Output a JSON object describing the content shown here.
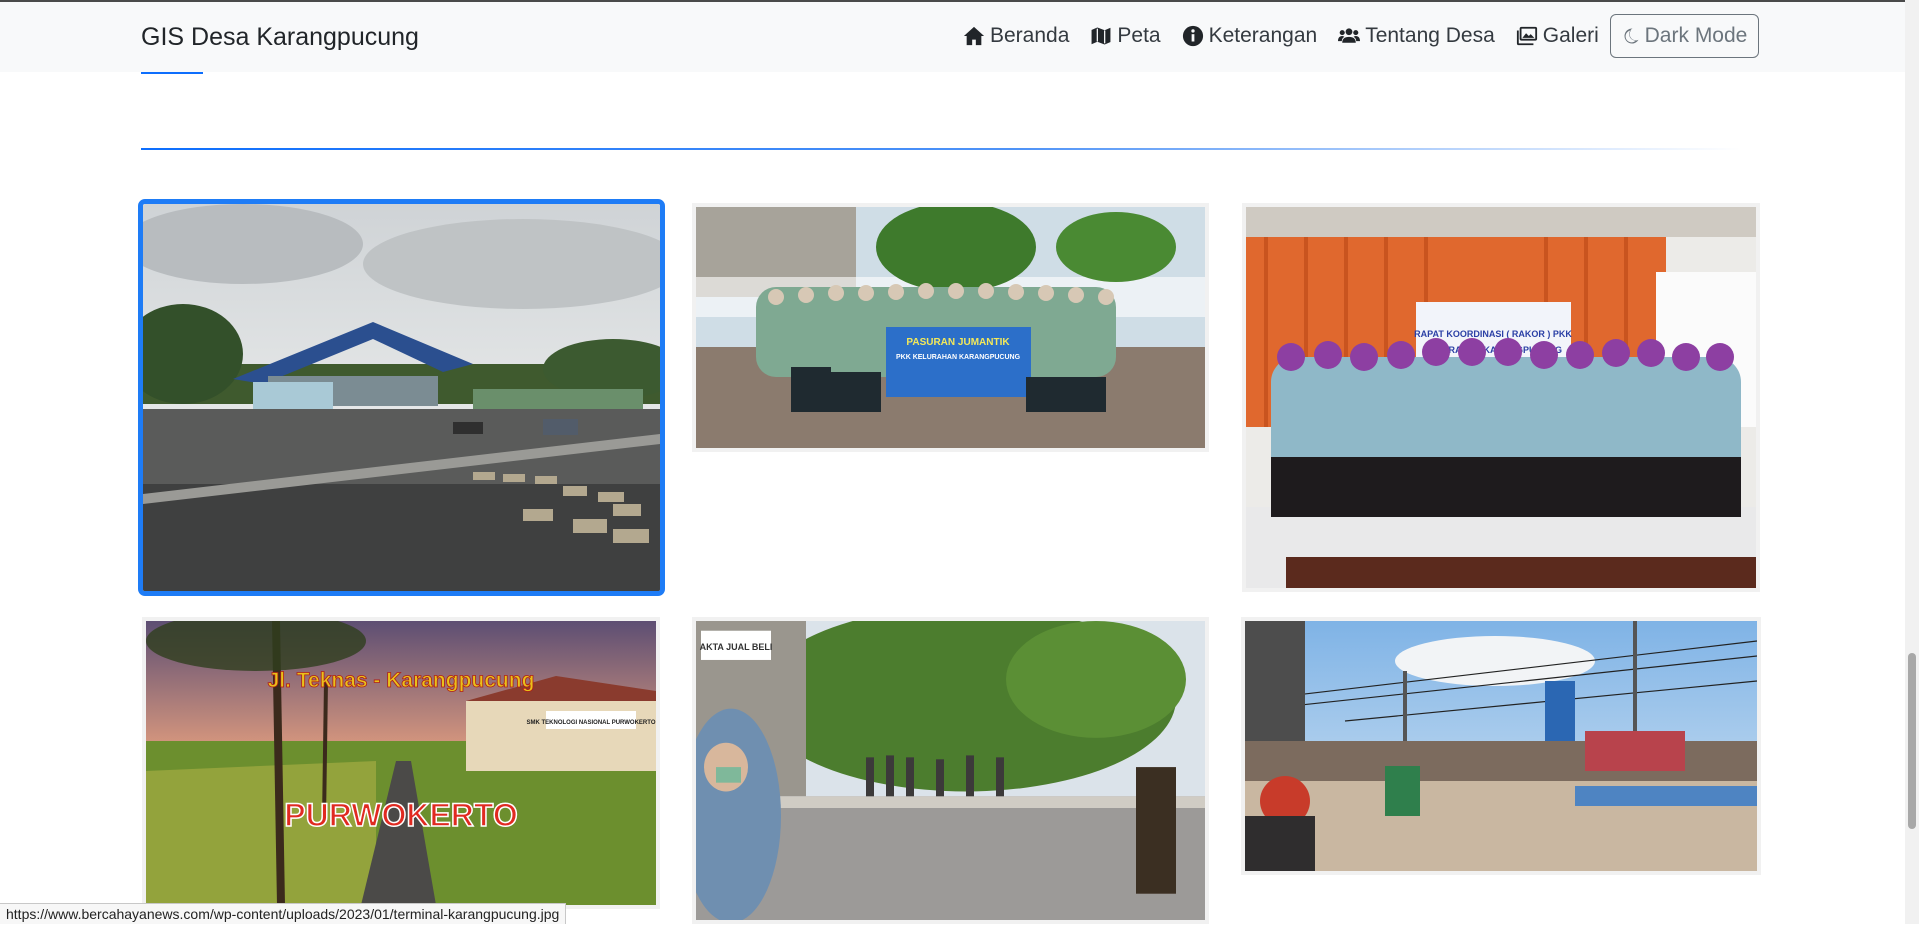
{
  "brand": "GIS Desa Karangpucung",
  "nav": {
    "items": [
      {
        "label": "Beranda",
        "icon": "home-icon"
      },
      {
        "label": "Peta",
        "icon": "map-icon"
      },
      {
        "label": "Keterangan",
        "icon": "info-circle-icon"
      },
      {
        "label": "Tentang Desa",
        "icon": "users-icon"
      },
      {
        "label": "Galeri",
        "icon": "images-icon"
      }
    ],
    "dark_mode_label": "Dark Mode",
    "dark_mode_icon": "moon-icon"
  },
  "gallery": {
    "items": [
      {
        "caption_texts": []
      },
      {
        "caption_texts": [
          "PASURAN JUMANTIK",
          "PKK KELURAHAN KARANGPUCUNG"
        ]
      },
      {
        "caption_texts": [
          "RAPAT KOORDINASI ( RAKOR ) PKK",
          "KELURAHAN KARANGPUCUNG"
        ]
      },
      {
        "caption_texts": [
          "Jl. Teknas - Karangpucung",
          "PURWOKERTO",
          "SMK TEKNOLOGI NASIONAL PURWOKERTO"
        ]
      },
      {
        "caption_texts": [
          "AKTA JUAL BELI"
        ]
      },
      {
        "caption_texts": []
      }
    ]
  },
  "status_url": "https://www.bercahayanews.com/wp-content/uploads/2023/01/terminal-karangpucung.jpg",
  "colors": {
    "accent": "#0d6efd",
    "active_border": "#1e7cf6",
    "navbar_bg": "#f8f9fa"
  }
}
